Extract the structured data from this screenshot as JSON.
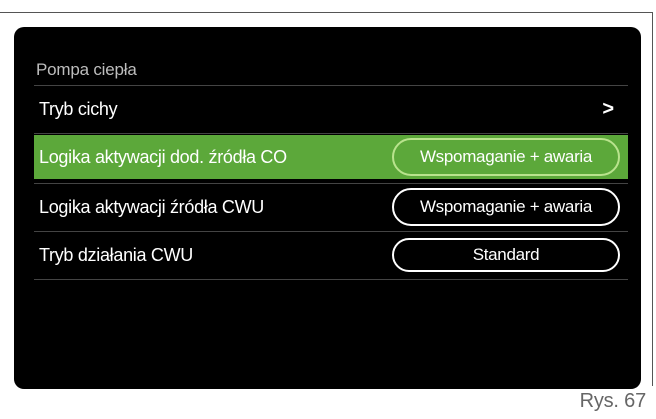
{
  "screen": {
    "title": "Pompa ciepła",
    "rows": [
      {
        "label": "Tryb cichy",
        "control": ">"
      },
      {
        "label": "Logika aktywacji dod. źródła CO",
        "control": "Wspomaganie + awaria",
        "selected": true
      },
      {
        "label": "Logika aktywacji źródła CWU",
        "control": "Wspomaganie + awaria"
      },
      {
        "label": "Tryb działania CWU",
        "control": "Standard"
      }
    ]
  },
  "caption": "Rys. 67",
  "colors": {
    "highlight": "#5ca83a",
    "screen_bg": "#000000"
  }
}
